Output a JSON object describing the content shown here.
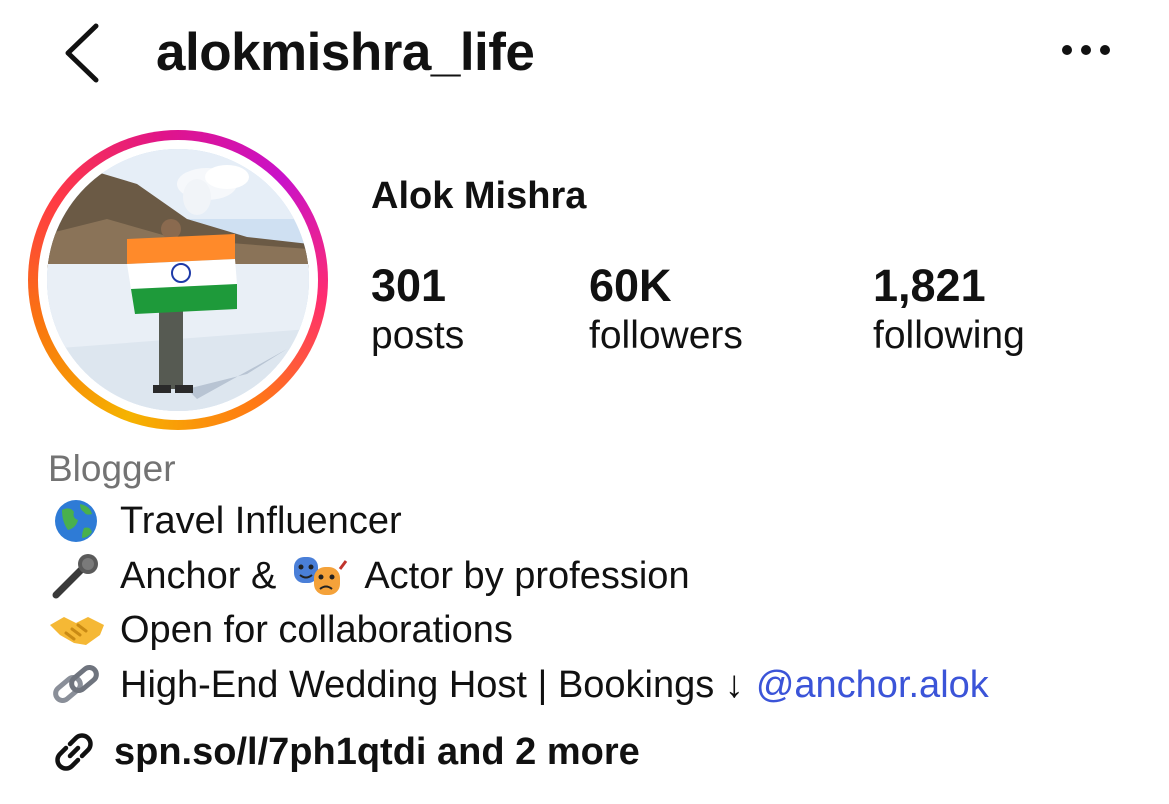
{
  "header": {
    "username": "alokmishra_life",
    "back_icon": "chevron-left-icon",
    "more_icon": "more-horizontal-icon"
  },
  "profile": {
    "display_name": "Alok Mishra",
    "stats": [
      {
        "count": "301",
        "label": "posts"
      },
      {
        "count": "60K",
        "label": "followers"
      },
      {
        "count": "1,821",
        "label": "following"
      }
    ],
    "avatar_ring_colors": [
      "#f5b300",
      "#ff3a44",
      "#e0148a",
      "#c912c9"
    ]
  },
  "bio": {
    "category": "Blogger",
    "lines": [
      {
        "icon": "globe-icon",
        "text": "Travel Influencer"
      },
      {
        "icon": "microphone-icon",
        "text_before": "Anchor &",
        "inline_icon": "performing-arts-icon",
        "text_after": "Actor by profession"
      },
      {
        "icon": "handshake-icon",
        "text": "Open for collaborations"
      },
      {
        "icon": "link-chain-icon",
        "text": "High-End Wedding Host | Bookings ↓",
        "mention": "@anchor.alok"
      }
    ],
    "mention_color": "#3b54d8"
  },
  "link": {
    "icon": "link-icon",
    "text": "spn.so/l/7ph1qtdi and 2 more"
  }
}
